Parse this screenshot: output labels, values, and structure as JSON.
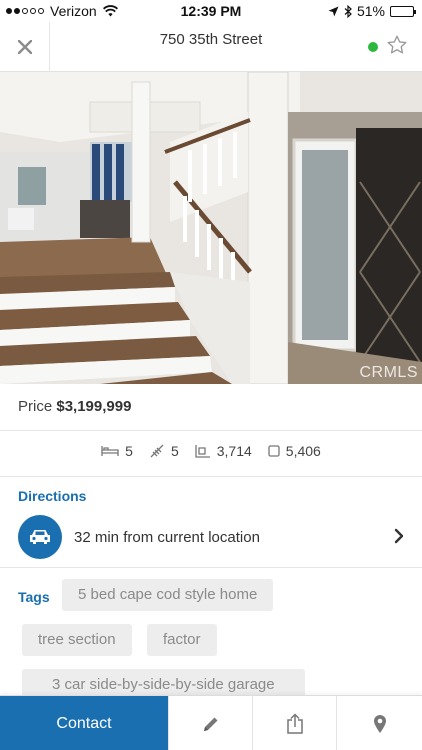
{
  "status_bar": {
    "carrier": "Verizon",
    "time": "12:39 PM",
    "battery": "51%",
    "battery_level": 0.51,
    "signal_bars_filled": 2,
    "signal_bars_total": 5
  },
  "header": {
    "title": "750 35th Street",
    "status_color": "#2db83d",
    "icons": [
      "close-icon",
      "star-icon"
    ]
  },
  "photo": {
    "watermark": "CRMLS"
  },
  "price": {
    "label": "Price",
    "value": "$3,199,999"
  },
  "stats": {
    "beds": "5",
    "baths": "5",
    "sqft": "3,714",
    "lot": "5,406",
    "icons": [
      "bed-icon",
      "bath-icon",
      "sqft-icon",
      "lot-icon"
    ]
  },
  "directions": {
    "label": "Directions",
    "text": "32 min from current location",
    "icon": "car-icon"
  },
  "tags": {
    "label": "Tags",
    "items": [
      "5 bed cape cod style home",
      "tree section",
      "factor",
      "3 car side-by-side-by-side garage"
    ]
  },
  "bottom_bar": {
    "contact_label": "Contact",
    "icons": [
      "pencil-icon",
      "share-icon",
      "location-pin-icon"
    ]
  },
  "colors": {
    "accent": "#1a6fb1",
    "tag_bg": "#ededed"
  }
}
